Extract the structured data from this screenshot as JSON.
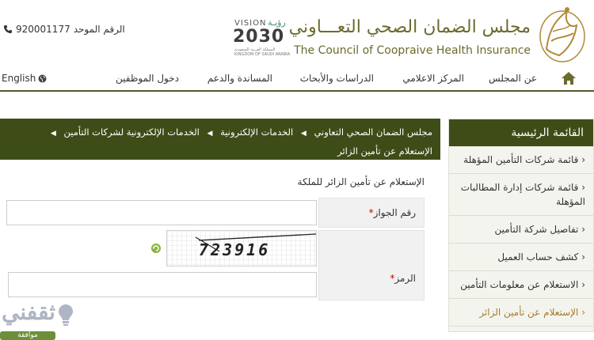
{
  "header": {
    "hotline_label": "الرقم الموحد",
    "hotline_number": "920001177",
    "council_name_ar": "مجلس الضمان الصحي التعـــاوني",
    "council_name_en": "The Council of Coopraive Health Insurance",
    "vision": {
      "title": "VISION",
      "title_ar": "رؤيـة",
      "year": "2030",
      "sub_ar": "المملكة العربية السعودية",
      "sub_en": "KINGDOM OF SAUDI ARABIA"
    },
    "logo_text": "مجلس الضمان الصحي التعاوني"
  },
  "nav": {
    "items": [
      "عن المجلس",
      "المركز الاعلامي",
      "الدراسات والأبحاث",
      "المساندة والدعم",
      "دخول الموظفين"
    ],
    "language": "English"
  },
  "breadcrumb": {
    "items": [
      "مجلس الضمان الصحي التعاوني",
      "الخدمات الإلكترونية",
      "الخدمات الإلكترونية لشركات التأمين",
      "الإستعلام عن تأمين الزائر"
    ]
  },
  "sidebar": {
    "title": "القائمة الرئيسية",
    "items": [
      "قائمة شركات التأمين المؤهلة",
      "قائمة شركات إدارة المطالبات المؤهلة",
      "تفاصيل شركة التأمين",
      "كشف حساب العميل",
      "الاستعلام عن معلومات التأمين",
      "الإستعلام عن تأمين الزائر"
    ],
    "active_index": 5
  },
  "form": {
    "page_title": "الإستعلام عن تأمين الزائر للملكة",
    "passport_label": "رقم الجواز",
    "captcha_label": "الرمز",
    "required_mark": "*",
    "passport_value": "",
    "captcha_value": "",
    "captcha_text": "723916"
  },
  "watermark": {
    "text": "ثقفني",
    "bar_text": "موافقة"
  },
  "colors": {
    "olive_dark": "#3e4d18",
    "olive_text": "#6b6b2e",
    "active_link": "#a77a2c",
    "nav_border": "#57592a"
  }
}
